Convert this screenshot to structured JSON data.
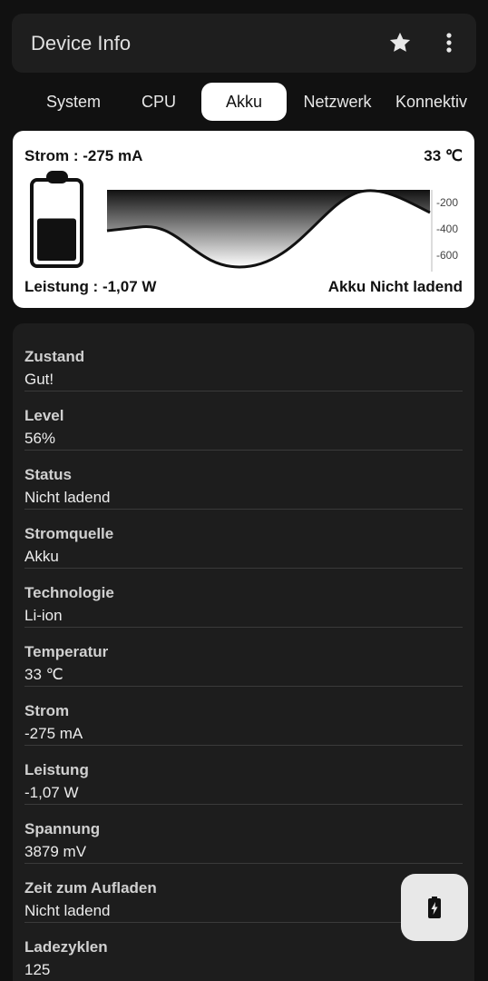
{
  "app": {
    "title": "Device Info"
  },
  "tabs": [
    "System",
    "CPU",
    "Akku",
    "Netzwerk",
    "Konnektiv"
  ],
  "active_tab": "Akku",
  "battery_card": {
    "current": "Strom : -275 mA",
    "temperature": "33 ℃",
    "power": "Leistung : -1,07 W",
    "charge_state": "Akku Nicht ladend",
    "level_fraction": 0.56,
    "graph_ticks": [
      "-200",
      "-400",
      "-600"
    ]
  },
  "details": [
    {
      "label": "Zustand",
      "value": "Gut!"
    },
    {
      "label": "Level",
      "value": "56%"
    },
    {
      "label": "Status",
      "value": "Nicht ladend"
    },
    {
      "label": "Stromquelle",
      "value": "Akku"
    },
    {
      "label": "Technologie",
      "value": "Li-ion"
    },
    {
      "label": "Temperatur",
      "value": "33 ℃"
    },
    {
      "label": "Strom",
      "value": "-275 mA"
    },
    {
      "label": "Leistung",
      "value": "-1,07 W"
    },
    {
      "label": "Spannung",
      "value": "3879 mV"
    },
    {
      "label": "Zeit zum Aufladen",
      "value": "Nicht ladend"
    },
    {
      "label": "Ladezyklen",
      "value": "125"
    }
  ],
  "icons": {
    "star": "star-icon",
    "more": "more-vert-icon",
    "fab": "battery-charging-icon"
  }
}
